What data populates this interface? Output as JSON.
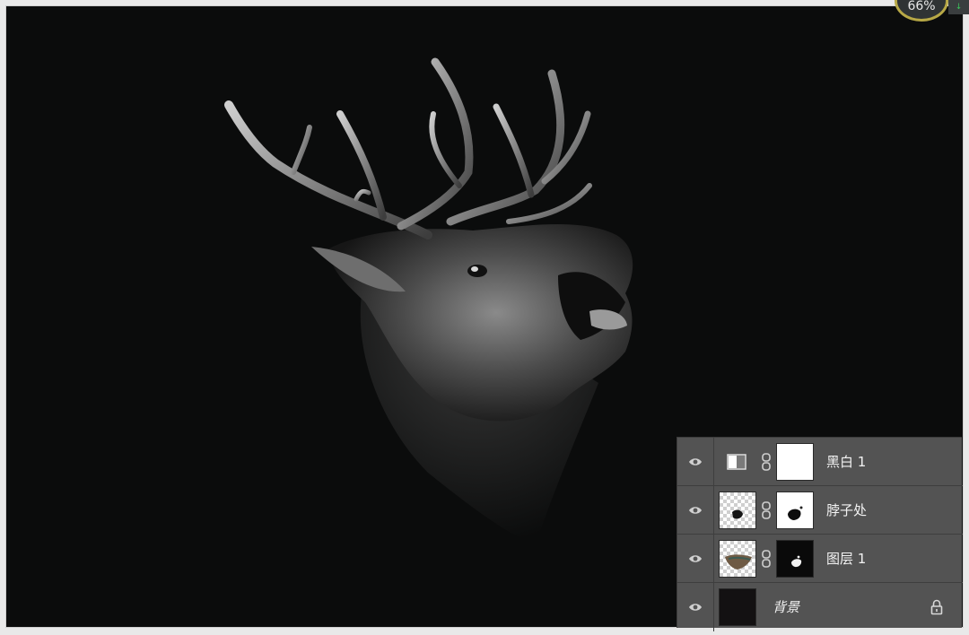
{
  "zoom": {
    "label": "66%"
  },
  "layers_panel": {
    "layers": [
      {
        "name": "黑白 1",
        "type": "adjustment-black-white",
        "visible": true
      },
      {
        "name": "脖子处",
        "type": "pixel-with-mask",
        "visible": true
      },
      {
        "name": "图层 1",
        "type": "pixel-with-mask",
        "visible": true
      },
      {
        "name": "背景",
        "type": "background",
        "visible": true,
        "locked": true
      }
    ]
  },
  "colors": {
    "canvas_background": "#0b0c0c",
    "panel_background": "#535353",
    "panel_text": "#f2f2f2",
    "zoom_ring": "#b7a846"
  }
}
